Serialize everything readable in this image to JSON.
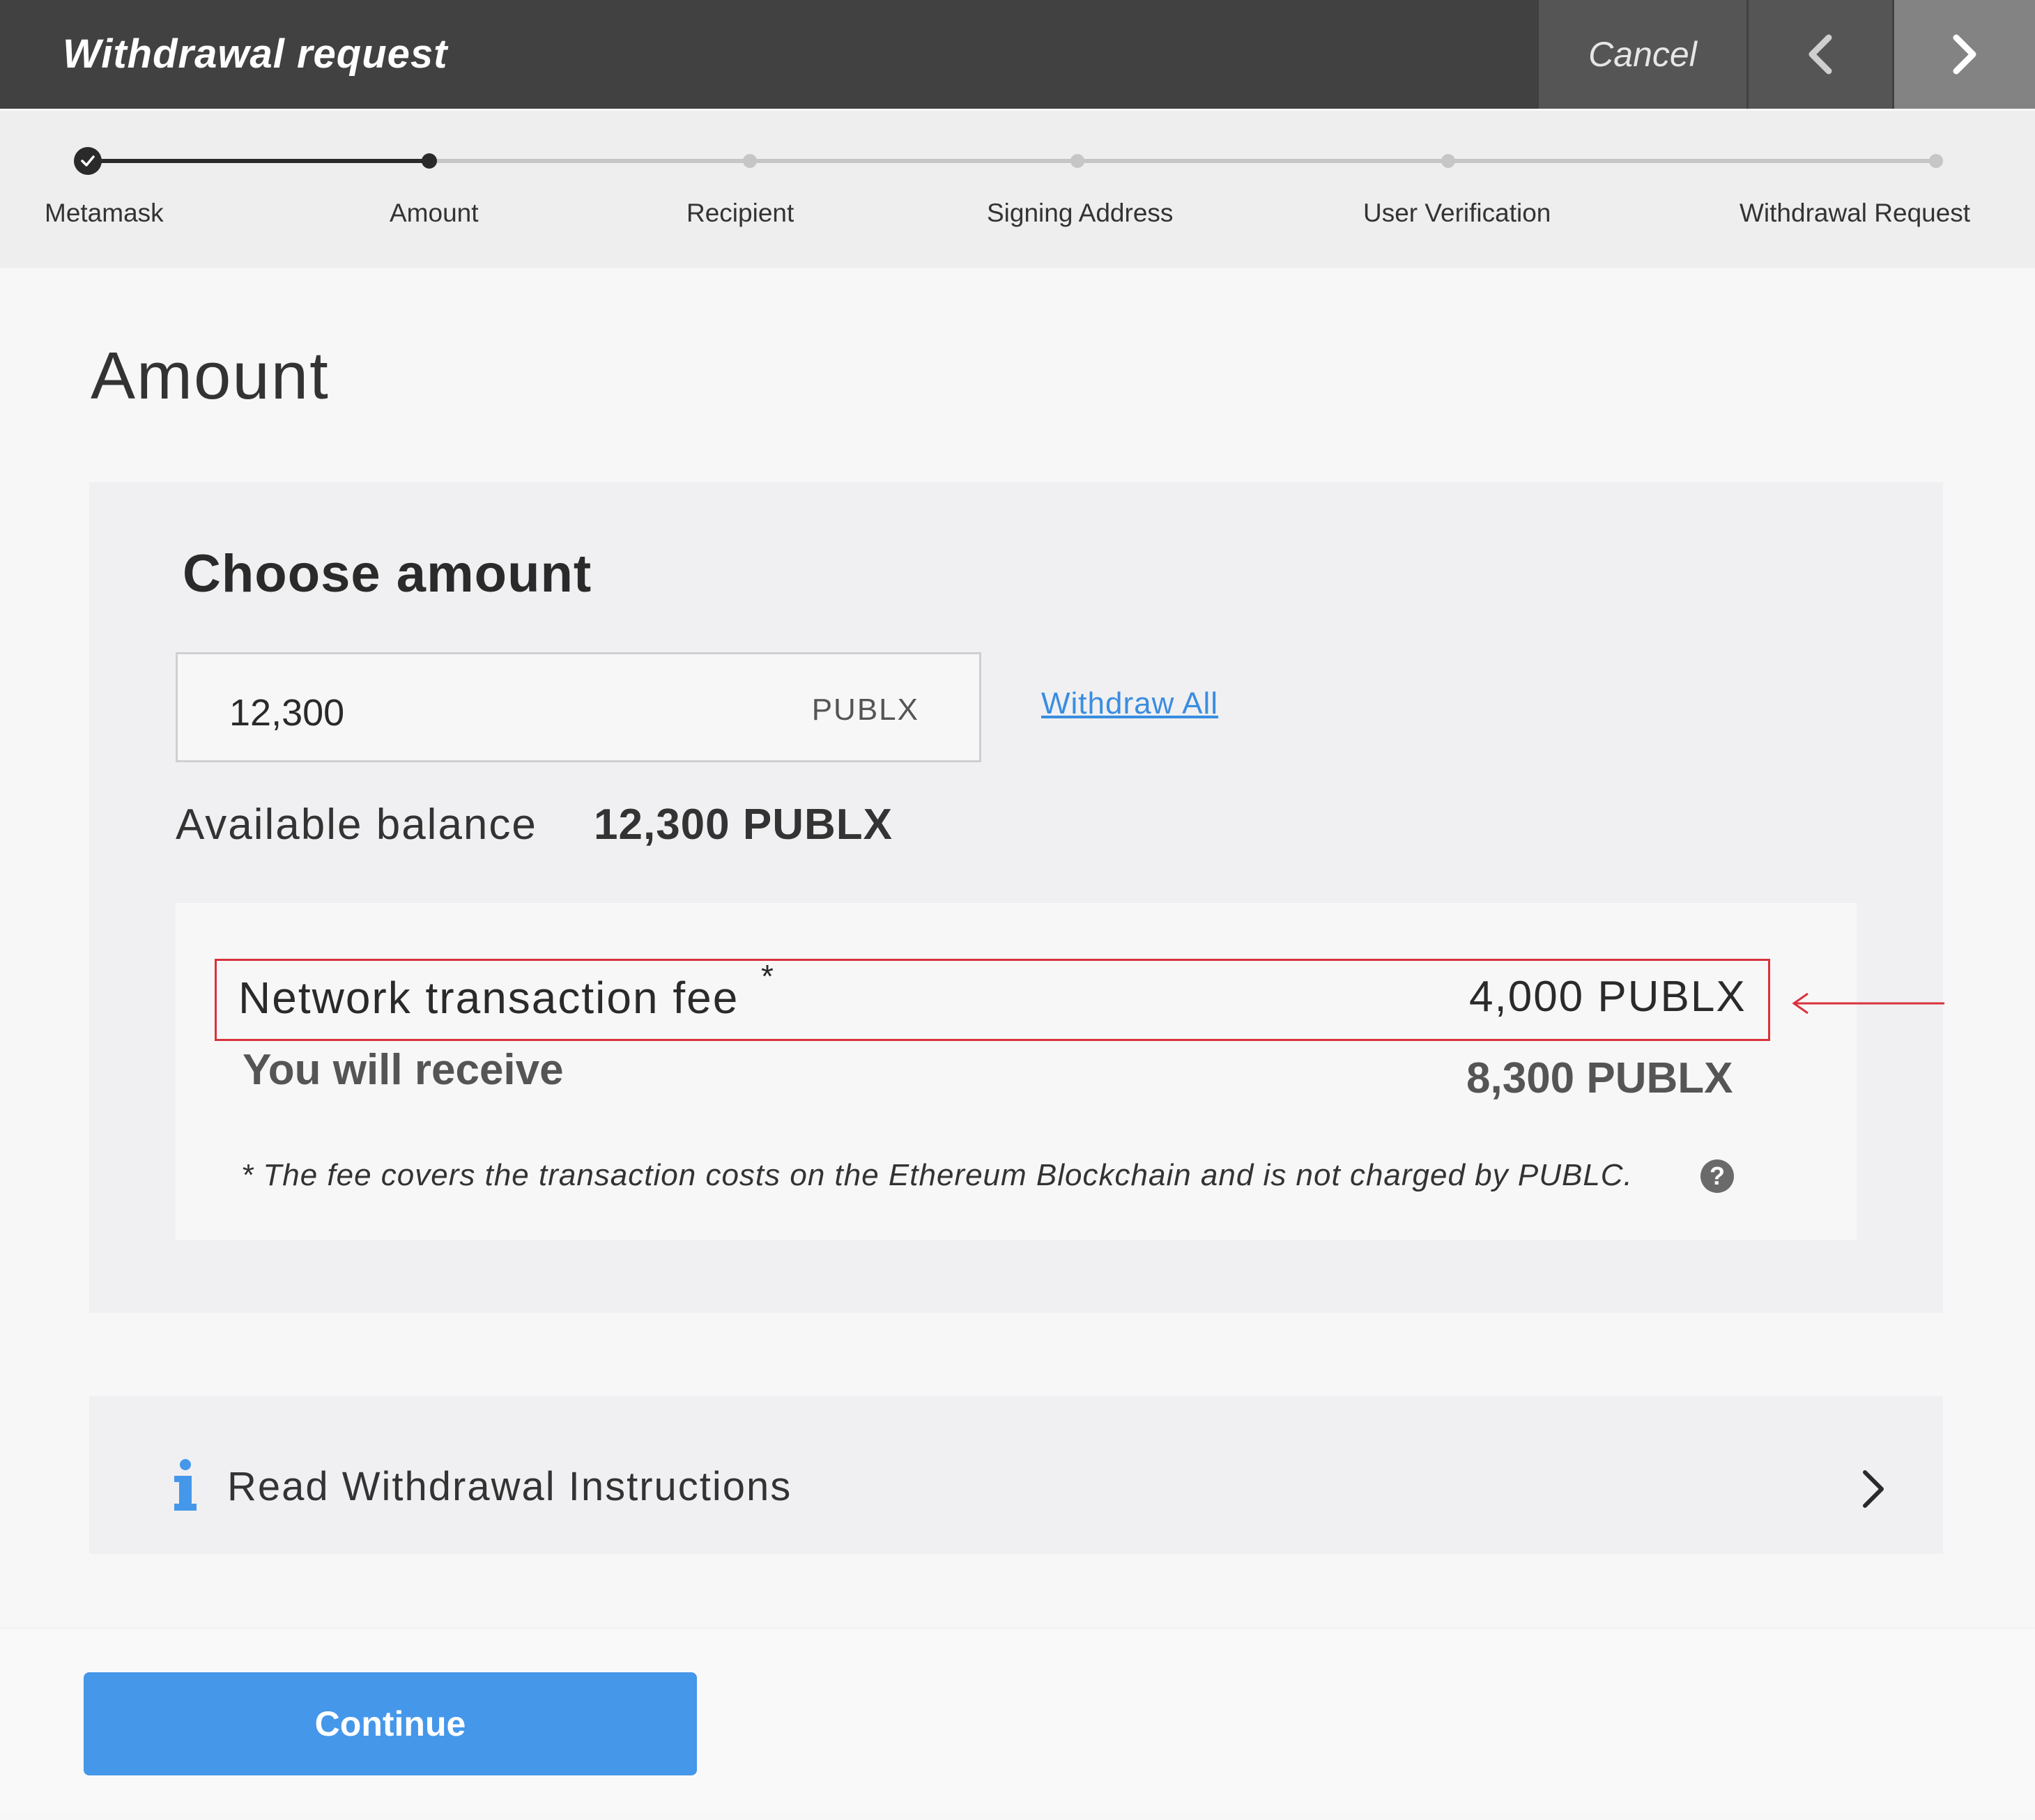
{
  "header": {
    "title": "Withdrawal request",
    "cancel_label": "Cancel"
  },
  "stepper": {
    "steps": [
      {
        "label": "Metamask",
        "state": "completed"
      },
      {
        "label": "Amount",
        "state": "current"
      },
      {
        "label": "Recipient",
        "state": "upcoming"
      },
      {
        "label": "Signing Address",
        "state": "upcoming"
      },
      {
        "label": "User Verification",
        "state": "upcoming"
      },
      {
        "label": "Withdrawal Request",
        "state": "upcoming"
      }
    ]
  },
  "page": {
    "title": "Amount"
  },
  "amount_card": {
    "title": "Choose amount",
    "input_value": "12,300",
    "unit": "PUBLX",
    "withdraw_all_label": "Withdraw All",
    "balance_label": "Available balance",
    "balance_value": "12,300 PUBLX"
  },
  "fees": {
    "fee_label": "Network transaction fee",
    "fee_marker": "*",
    "fee_value": "4,000 PUBLX",
    "receive_label": "You will receive",
    "receive_value": "8,300 PUBLX",
    "note": "* The fee covers the transaction costs on the Ethereum Blockchain and is not charged by PUBLC.",
    "help_symbol": "?"
  },
  "instructions": {
    "label": "Read Withdrawal Instructions"
  },
  "footer": {
    "continue_label": "Continue"
  },
  "colors": {
    "header_bg": "#414141",
    "accent_blue": "#4597ea",
    "link_blue": "#3a8de0",
    "highlight_red": "#d9323c"
  }
}
